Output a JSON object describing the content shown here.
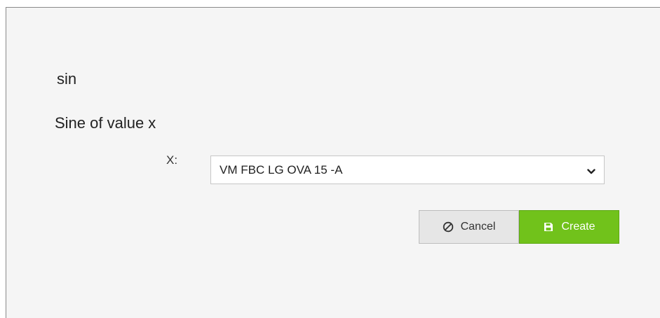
{
  "function": {
    "name": "sin",
    "description": "Sine of value x"
  },
  "parameter": {
    "label": "X:",
    "selected_value": "VM FBC LG OVA 15 -A"
  },
  "buttons": {
    "cancel_label": "Cancel",
    "cancel_icon": "ban-icon",
    "create_label": "Create",
    "create_icon": "floppy-disk-icon"
  },
  "colors": {
    "create_accent": "#71c21b",
    "cancel_bg": "#e6e6e6",
    "panel_bg": "#f5f5f5"
  }
}
